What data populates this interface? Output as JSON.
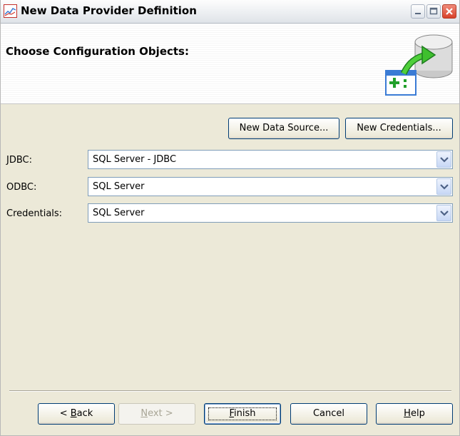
{
  "window": {
    "title": "New Data Provider Definition"
  },
  "header": {
    "title": "Choose Configuration Objects:"
  },
  "actions": {
    "new_data_source": "New Data Source...",
    "new_credentials": "New Credentials..."
  },
  "fields": {
    "jdbc": {
      "label": "JDBC:",
      "value": "SQL Server - JDBC"
    },
    "odbc": {
      "label": "ODBC:",
      "value": "SQL Server"
    },
    "credentials": {
      "label": "Credentials:",
      "value": "SQL Server"
    }
  },
  "footer": {
    "back": {
      "prefix": "< ",
      "accel": "B",
      "rest": "ack"
    },
    "next": {
      "accel": "N",
      "rest": "ext >"
    },
    "finish": {
      "accel": "F",
      "rest": "inish"
    },
    "cancel": "Cancel",
    "help": {
      "accel": "H",
      "rest": "elp"
    }
  },
  "icons": {
    "app": "chart-icon",
    "minimize": "minimize-icon",
    "maximize": "maximize-icon",
    "close": "close-icon",
    "header": "database-add-icon",
    "dropdown": "chevron-down-icon"
  },
  "colors": {
    "dialog_bg": "#ece9d8",
    "button_border": "#003c74",
    "close_button": "#d8412a"
  }
}
